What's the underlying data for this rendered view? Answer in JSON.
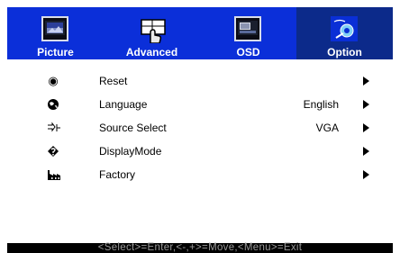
{
  "tabs": [
    {
      "label": "Picture",
      "icon": "picture-icon"
    },
    {
      "label": "Advanced",
      "icon": "advanced-hand-icon"
    },
    {
      "label": "OSD",
      "icon": "osd-icon"
    },
    {
      "label": "Option",
      "icon": "option-icon",
      "active": true
    }
  ],
  "menu": {
    "items": [
      {
        "label": "Reset",
        "value": "",
        "icon": "reset-icon"
      },
      {
        "label": "Language",
        "value": "English",
        "icon": "language-globe-icon"
      },
      {
        "label": "Source Select",
        "value": "VGA",
        "icon": "source-select-icon"
      },
      {
        "label": "DisplayMode",
        "value": "",
        "icon": "display-mode-icon"
      },
      {
        "label": "Factory",
        "value": "",
        "icon": "factory-icon"
      }
    ]
  },
  "status": {
    "text": "<Select>=Enter,<-,+>=Move,<Menu>=Exit"
  },
  "colors": {
    "tab_bar": "#0b2fd9",
    "active_tab": "#0c2a8a",
    "status_bg": "#000000",
    "status_text": "#9a9a9a"
  }
}
